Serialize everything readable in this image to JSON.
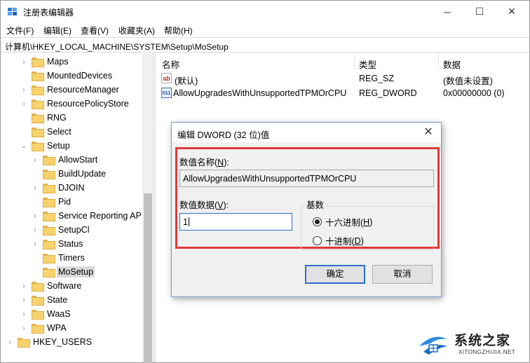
{
  "window": {
    "title": "注册表编辑器",
    "controls": {
      "minimize": "─",
      "maximize": "☐",
      "close": "✕"
    }
  },
  "menubar": {
    "items": [
      {
        "label": "文件(F)"
      },
      {
        "label": "编辑(E)"
      },
      {
        "label": "查看(V)"
      },
      {
        "label": "收藏夹(A)"
      },
      {
        "label": "帮助(H)"
      }
    ]
  },
  "address": {
    "path": "计算机\\HKEY_LOCAL_MACHINE\\SYSTEM\\Setup\\MoSetup"
  },
  "tree": {
    "items": [
      {
        "label": "Maps",
        "level": 1,
        "chevron": "›"
      },
      {
        "label": "MountedDevices",
        "level": 1,
        "chevron": ""
      },
      {
        "label": "ResourceManager",
        "level": 1,
        "chevron": "›"
      },
      {
        "label": "ResourcePolicyStore",
        "level": 1,
        "chevron": "›"
      },
      {
        "label": "RNG",
        "level": 1,
        "chevron": ""
      },
      {
        "label": "Select",
        "level": 1,
        "chevron": ""
      },
      {
        "label": "Setup",
        "level": 1,
        "chevron": "⌄"
      },
      {
        "label": "AllowStart",
        "level": 2,
        "chevron": "›"
      },
      {
        "label": "BuildUpdate",
        "level": 2,
        "chevron": ""
      },
      {
        "label": "DJOIN",
        "level": 2,
        "chevron": "›"
      },
      {
        "label": "Pid",
        "level": 2,
        "chevron": ""
      },
      {
        "label": "Service Reporting AP",
        "level": 2,
        "chevron": "›"
      },
      {
        "label": "SetupCl",
        "level": 2,
        "chevron": "›"
      },
      {
        "label": "Status",
        "level": 2,
        "chevron": "›"
      },
      {
        "label": "Timers",
        "level": 2,
        "chevron": ""
      },
      {
        "label": "MoSetup",
        "level": 2,
        "chevron": "",
        "selected": true
      },
      {
        "label": "Software",
        "level": 1,
        "chevron": "›"
      },
      {
        "label": "State",
        "level": 1,
        "chevron": "›"
      },
      {
        "label": "WaaS",
        "level": 1,
        "chevron": "›"
      },
      {
        "label": "WPA",
        "level": 1,
        "chevron": "›"
      },
      {
        "label": "HKEY_USERS",
        "level": 0,
        "chevron": "›"
      }
    ]
  },
  "list": {
    "columns": {
      "name": "名称",
      "type": "类型",
      "data": "数据"
    },
    "rows": [
      {
        "icon": "string-value-icon",
        "icon_text": "ab",
        "name": "(默认)",
        "type": "REG_SZ",
        "data": "(数值未设置)"
      },
      {
        "icon": "dword-value-icon",
        "icon_text": "011",
        "name": "AllowUpgradesWithUnsupportedTPMOrCPU",
        "type": "REG_DWORD",
        "data": "0x00000000 (0)"
      }
    ]
  },
  "dialog": {
    "title": "编辑 DWORD (32 位)值",
    "close": "✕",
    "value_name_label": "数值名称(",
    "value_name_key": "N",
    "value_name_label_end": "):",
    "value_name": "AllowUpgradesWithUnsupportedTPMOrCPU",
    "value_data_label": "数值数据(",
    "value_data_key": "V",
    "value_data_label_end": "):",
    "value_data": "1",
    "base_label": "基数",
    "radio_hex_label": "十六进制(",
    "radio_hex_key": "H",
    "radio_hex_end": ")",
    "radio_dec_label": "十进制(",
    "radio_dec_key": "D",
    "radio_dec_end": ")",
    "base_selected": "hex",
    "ok": "确定",
    "cancel": "取消",
    "highlight_color": "#e03838"
  },
  "watermark": {
    "text": "系统之家",
    "sub": "XITONGZHIJIA.NET"
  }
}
